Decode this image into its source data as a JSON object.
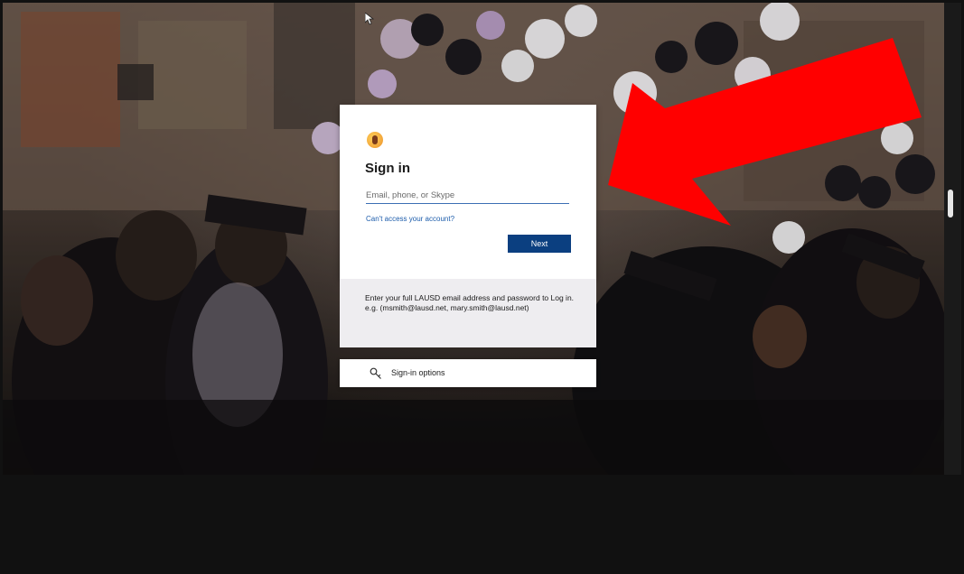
{
  "signin": {
    "title": "Sign in",
    "email_placeholder": "Email, phone, or Skype",
    "email_value": "",
    "cant_access_label": "Can't access your account?",
    "next_label": "Next"
  },
  "info": {
    "text": "Enter your full LAUSD email address and password to Log in. e.g. (msmith@lausd.net, mary.smith@lausd.net)"
  },
  "options": {
    "label": "Sign-in options",
    "icon": "key-icon"
  },
  "annotation": {
    "arrow_color": "#ff0000"
  },
  "colors": {
    "primary_button": "#0b3f80",
    "link": "#1c5cab",
    "info_panel": "#eeedf0"
  }
}
